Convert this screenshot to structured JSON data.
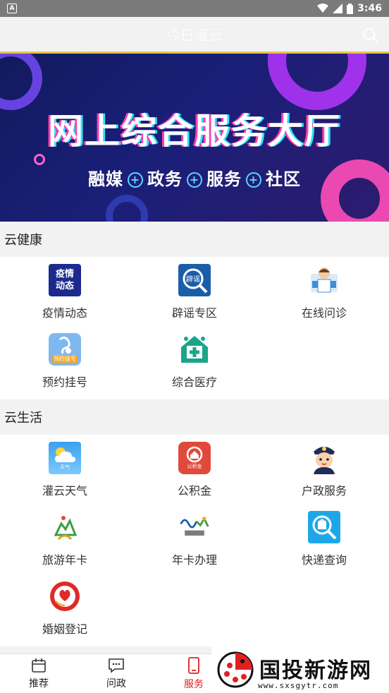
{
  "status_bar": {
    "time": "3:46",
    "left_badge": "A"
  },
  "app_bar": {
    "title": "今日灌云"
  },
  "banner": {
    "headline": "网上综合服务大厅",
    "sub_items": [
      "融媒",
      "政务",
      "服务",
      "社区"
    ]
  },
  "sections": [
    {
      "title": "云健康",
      "items": [
        {
          "label": "疫情动态",
          "icon": "epidemic-icon"
        },
        {
          "label": "辟谣专区",
          "icon": "rumor-icon"
        },
        {
          "label": "在线问诊",
          "icon": "doctor-icon"
        },
        {
          "label": "预约挂号",
          "icon": "appointment-icon"
        },
        {
          "label": "综合医疗",
          "icon": "hospital-icon"
        }
      ]
    },
    {
      "title": "云生活",
      "items": [
        {
          "label": "灌云天气",
          "icon": "weather-icon"
        },
        {
          "label": "公积金",
          "icon": "housing-fund-icon"
        },
        {
          "label": "户政服务",
          "icon": "police-icon"
        },
        {
          "label": "旅游年卡",
          "icon": "tourism-card-icon"
        },
        {
          "label": "年卡办理",
          "icon": "annual-card-icon"
        },
        {
          "label": "快递查询",
          "icon": "express-icon"
        },
        {
          "label": "婚姻登记",
          "icon": "marriage-icon"
        }
      ]
    }
  ],
  "icon_texts": {
    "epidemic": "疫情\n动态",
    "rumor": "辟谣",
    "appointment": "预约挂号",
    "housing": "公积金",
    "weather": "天气"
  },
  "tab_bar": [
    {
      "label": "推荐"
    },
    {
      "label": "问政"
    },
    {
      "label": "服务"
    }
  ],
  "watermark": {
    "text": "国投新游网",
    "url": "www.sxsgytr.com"
  },
  "colors": {
    "accent_red": "#e02020",
    "banner_bg": "#1a1f78",
    "divider": "#e5c24b"
  }
}
